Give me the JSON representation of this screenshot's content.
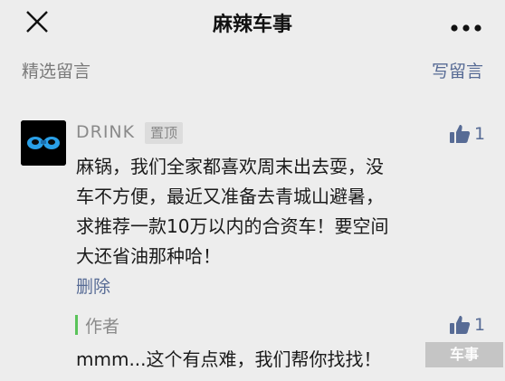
{
  "header": {
    "title": "麻辣车事",
    "close_icon": "close-icon",
    "more_icon": "more-dots-icon"
  },
  "section": {
    "label": "精选留言",
    "write_label": "写留言"
  },
  "comment": {
    "nickname": "DRINK",
    "pin_badge": "置顶",
    "likes": "1",
    "lines": [
      "麻锅，我们全家都喜欢周末出去耍，没",
      "车不方便，最近又准备去青城山避暑，",
      "求推荐一款10万以内的合资车！要空间",
      "大还省油那种哈！"
    ],
    "delete_label": "删除",
    "reply": {
      "author": "作者",
      "likes": "1",
      "text": "mmm...这个有点难，我们帮你找找！"
    }
  },
  "watermark": "车事",
  "colors": {
    "background": "#ededed",
    "link": "#576b95",
    "reply_bar": "#5ac35a"
  }
}
